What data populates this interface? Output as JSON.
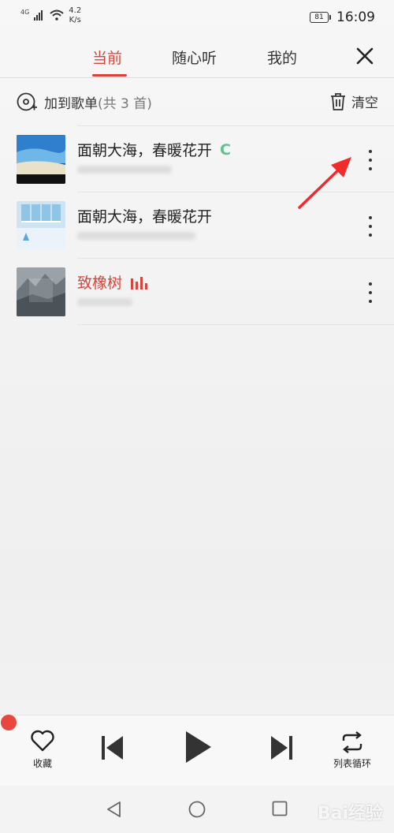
{
  "status": {
    "network": "4G",
    "speed_value": "4.2",
    "speed_unit": "K/s",
    "battery": "81",
    "time": "16:09"
  },
  "tabs": [
    "当前",
    "随心听",
    "我的"
  ],
  "toolbar": {
    "add_label": "加到歌单",
    "count_label": "(共 3 首)",
    "clear_label": "清空"
  },
  "songs": [
    {
      "title": "面朝大海，春暖花开",
      "badge": "C"
    },
    {
      "title": "面朝大海，春暖花开"
    },
    {
      "title": "致橡树",
      "playing": true
    }
  ],
  "controls": {
    "favorite_label": "收藏",
    "repeat_label": "列表循环"
  },
  "watermark": "Bai经验",
  "colors": {
    "accent": "#d8443c",
    "badge": "#5cc48d",
    "progress": "#e8473f"
  }
}
